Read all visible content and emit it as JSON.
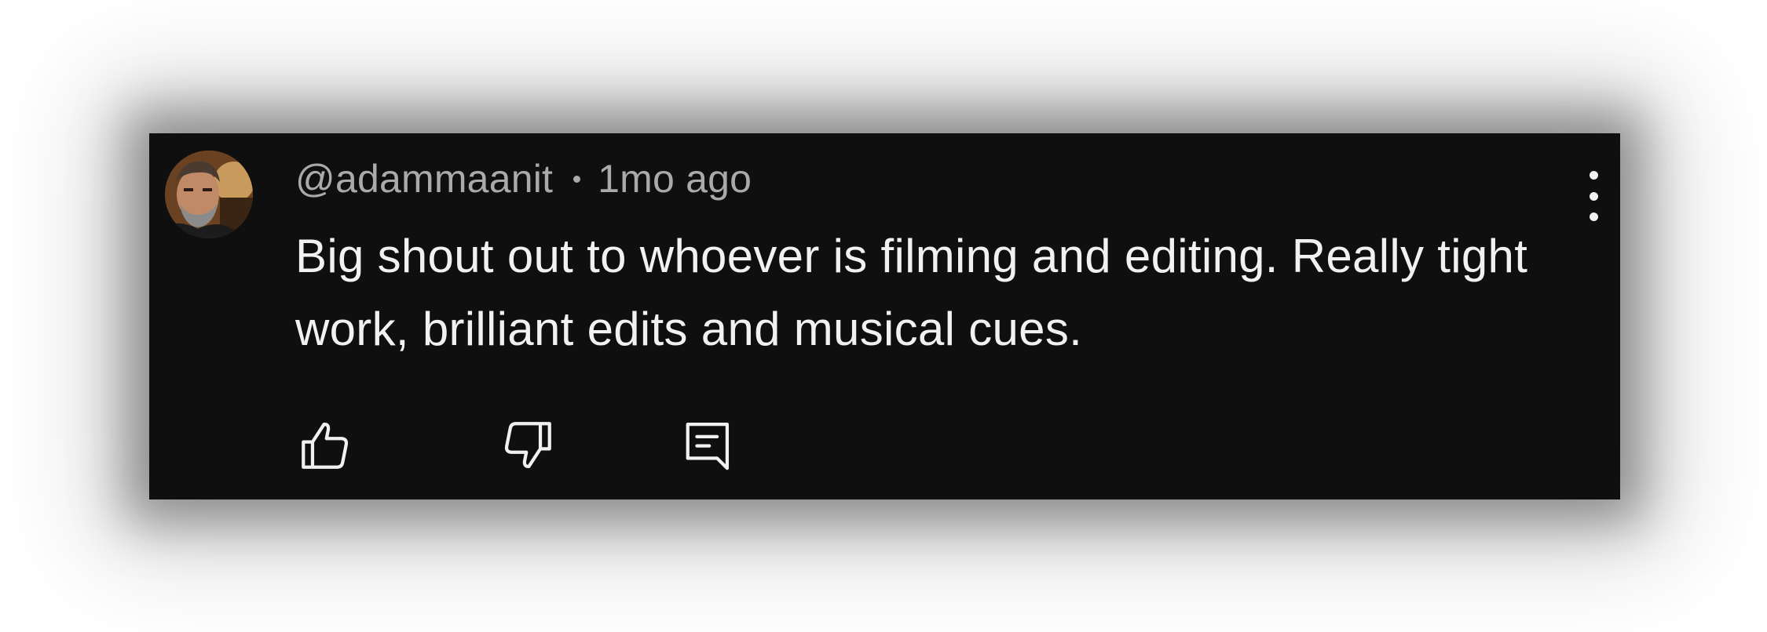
{
  "comment": {
    "handle": "@adammaanit",
    "time_ago": "1mo ago",
    "text": "Big shout out to whoever is filming and editing. Really tight work, brilliant edits and musical cues."
  },
  "icons": {
    "avatar": "avatar",
    "more": "more-vert-icon",
    "like": "thumb-up-icon",
    "dislike": "thumb-down-icon",
    "reply": "reply-comment-icon"
  },
  "colors": {
    "card_background": "#0f0f0f",
    "primary_text": "#f1f1f1",
    "secondary_text": "#aaaaaa"
  }
}
